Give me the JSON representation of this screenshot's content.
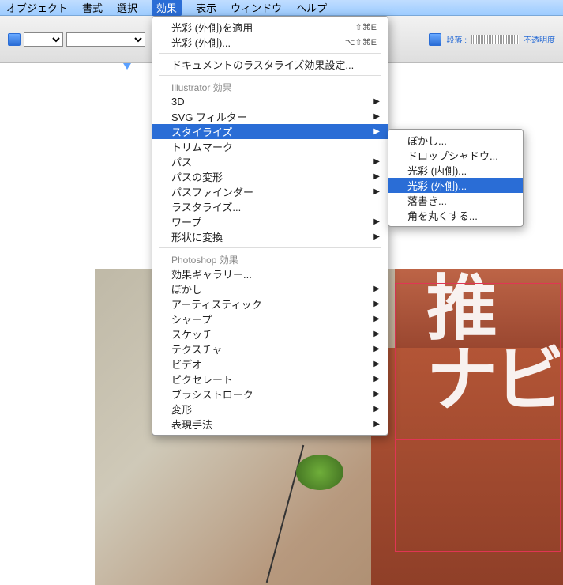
{
  "menubar": {
    "items": [
      "オブジェクト",
      "書式",
      "選択",
      "効果",
      "表示",
      "ウィンドウ",
      "ヘルプ"
    ],
    "selected_index": 3
  },
  "toolbar": {
    "paragraph_label": "段落 :",
    "opacity_label": "不透明度"
  },
  "effects_menu": {
    "recent1": {
      "label": "光彩 (外側)を適用",
      "shortcut": "⇧⌘E"
    },
    "recent2": {
      "label": "光彩 (外側)...",
      "shortcut": "⌥⇧⌘E"
    },
    "rasterize": "ドキュメントのラスタライズ効果設定...",
    "illustrator_header": "Illustrator 効果",
    "illustrator_items": [
      {
        "label": "3D",
        "sub": true
      },
      {
        "label": "SVG フィルター",
        "sub": true
      },
      {
        "label": "スタイライズ",
        "sub": true,
        "highlight": true
      },
      {
        "label": "トリムマーク",
        "sub": false
      },
      {
        "label": "パス",
        "sub": true
      },
      {
        "label": "パスの変形",
        "sub": true
      },
      {
        "label": "パスファインダー",
        "sub": true
      },
      {
        "label": "ラスタライズ...",
        "sub": false
      },
      {
        "label": "ワープ",
        "sub": true
      },
      {
        "label": "形状に変換",
        "sub": true
      }
    ],
    "photoshop_header": "Photoshop 効果",
    "photoshop_items": [
      "効果ギャラリー...",
      "ぼかし",
      "アーティスティック",
      "シャープ",
      "スケッチ",
      "テクスチャ",
      "ビデオ",
      "ピクセレート",
      "ブラシストローク",
      "変形",
      "表現手法"
    ]
  },
  "stylize_submenu": {
    "items": [
      {
        "label": "ぼかし..."
      },
      {
        "label": "ドロップシャドウ..."
      },
      {
        "label": "光彩 (内側)..."
      },
      {
        "label": "光彩 (外側)...",
        "highlight": true
      },
      {
        "label": "落書き..."
      },
      {
        "label": "角を丸くする..."
      }
    ]
  },
  "canvas_text": {
    "line1": "推",
    "line2": "ナビ"
  }
}
